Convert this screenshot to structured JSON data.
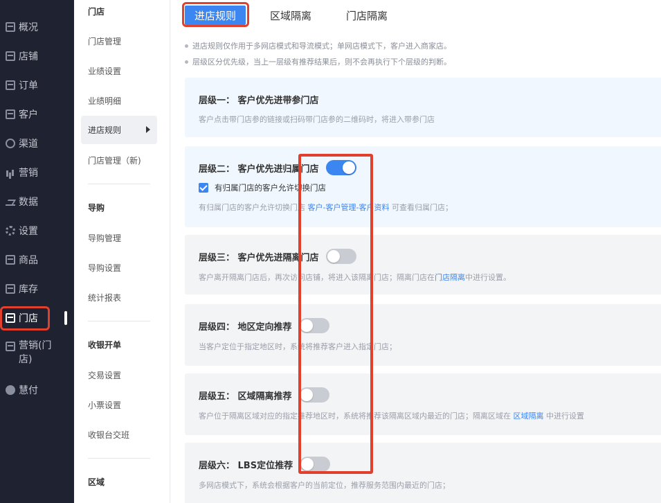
{
  "main_nav": {
    "items": [
      {
        "label": "概况",
        "icon": "dashboard-icon",
        "active": false
      },
      {
        "label": "店铺",
        "icon": "shop-icon",
        "active": false
      },
      {
        "label": "订单",
        "icon": "order-icon",
        "active": false
      },
      {
        "label": "客户",
        "icon": "customer-icon",
        "active": false
      },
      {
        "label": "渠道",
        "icon": "channel-icon",
        "active": false
      },
      {
        "label": "营销",
        "icon": "marketing-icon",
        "active": false
      },
      {
        "label": "数据",
        "icon": "data-icon",
        "active": false
      },
      {
        "label": "设置",
        "icon": "settings-icon",
        "active": false
      },
      {
        "label": "商品",
        "icon": "goods-icon",
        "active": false
      },
      {
        "label": "库存",
        "icon": "stock-icon",
        "active": false
      },
      {
        "label": "门店",
        "icon": "store-icon",
        "active": true
      },
      {
        "label": "营销(门店)",
        "label_line1": "营销(门",
        "label_line2": "店)",
        "icon": "store-marketing-icon",
        "active": false
      },
      {
        "label": "慧付",
        "icon": "pay-icon",
        "active": false
      }
    ]
  },
  "sub_nav": {
    "store_section": "门店",
    "store_items": [
      "门店管理",
      "业绩设置",
      "业绩明细",
      "进店规则",
      "门店管理（新)"
    ],
    "active_item": "进店规则",
    "guide_section": "导购",
    "guide_items": [
      "导购管理",
      "导购设置",
      "统计报表"
    ],
    "cashier_section": "收银开单",
    "cashier_items": [
      "交易设置",
      "小票设置",
      "收银台交班"
    ],
    "region_section": "区域"
  },
  "tabs": [
    {
      "label": "进店规则",
      "active": true
    },
    {
      "label": "区域隔离",
      "active": false
    },
    {
      "label": "门店隔离",
      "active": false
    }
  ],
  "notes": [
    "进店规则仅作用于多网店模式和导流模式；单网店模式下，客户进入商家店。",
    "层级区分优先级，当上一层级有推荐结果后，则不会再执行下个层级的判断。"
  ],
  "levels": [
    {
      "title": "层级一：  客户优先进带参门店",
      "desc": "客户点击带门店参的链接或扫码带门店参的二维码时，将进入带参门店",
      "has_switch": false
    },
    {
      "title": "层级二：  客户优先进归属门店",
      "has_switch": true,
      "switch_on": 1,
      "checkbox_label": "有归属门店的客户允许切换门店",
      "checkbox_checked": 1,
      "desc_prefix": "有归属门店的客户允许切换门店 ",
      "desc_link": "客户-客户管理-客户资料",
      "desc_suffix": " 可查看归属门店；"
    },
    {
      "title": "层级三：  客户优先进隔离门店",
      "has_switch": true,
      "switch_on": 0,
      "desc_prefix": "客户离开隔离门店后，再次访问店铺，将进入该隔离门店；隔离门店在",
      "desc_link": "门店隔离",
      "desc_suffix": "中进行设置。"
    },
    {
      "title": "层级四：  地区定向推荐",
      "has_switch": true,
      "switch_on": 0,
      "desc": "当客户定位于指定地区时，系统将推荐客户进入指定门店；"
    },
    {
      "title": "层级五：  区域隔离推荐",
      "has_switch": true,
      "switch_on": 0,
      "desc_prefix": "客户位于隔离区域对应的指定推荐地区时，系统将推荐该隔离区域内最近的门店；隔离区域在 ",
      "desc_link": "区域隔离",
      "desc_suffix": " 中进行设置"
    },
    {
      "title": "层级六：  LBS定位推荐",
      "has_switch": true,
      "switch_on": 0,
      "desc": "多网店模式下，系统会根据客户的当前定位，推荐服务范围内最近的门店；"
    }
  ],
  "colors": {
    "accent": "#3b86f1",
    "highlight": "#e0402c",
    "sidebar_bg": "#1f2231"
  }
}
